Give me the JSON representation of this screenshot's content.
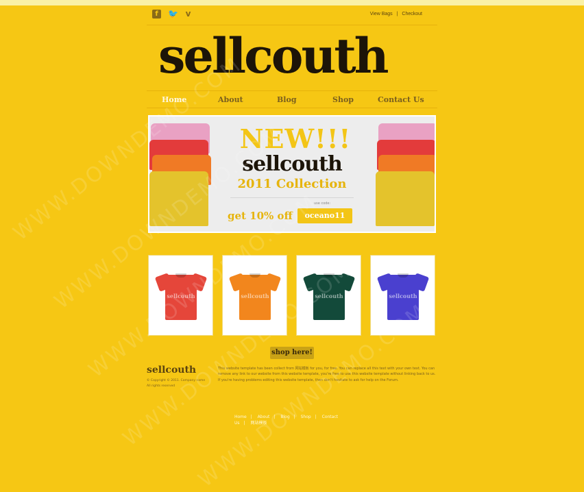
{
  "colors": {
    "background": "#f6c714",
    "accent": "#f3c516",
    "dark": "#1c1408"
  },
  "social": {
    "facebook_icon": "facebook-icon",
    "twitter_icon": "twitter-icon",
    "vimeo_icon": "vimeo-icon"
  },
  "toplinks": {
    "view_bags": "View Bags",
    "sep": "|",
    "checkout": "Checkout"
  },
  "logo": {
    "text": "sellcouth"
  },
  "nav": {
    "items": [
      {
        "label": "Home",
        "active": true
      },
      {
        "label": "About"
      },
      {
        "label": "Blog"
      },
      {
        "label": "Shop"
      },
      {
        "label": "Contact Us"
      }
    ]
  },
  "banner": {
    "new_label": "NEW!!!",
    "brand": "sellcouth",
    "collection": "2011 Collection",
    "use_code": "use code:",
    "discount": "get 10% off",
    "code": "oceano11"
  },
  "products": [
    {
      "name": "sellcouth",
      "color": "#e5463a"
    },
    {
      "name": "sellcouth",
      "color": "#f2861d"
    },
    {
      "name": "sellcouth",
      "color": "#134a3a"
    },
    {
      "name": "sellcouth",
      "color": "#4a40cf"
    }
  ],
  "shop_button": "shop here!",
  "footer": {
    "logo": "sellcouth",
    "copyright": "© Copyright © 2011. Company name All rights reserved",
    "text": "This website template has been collect from 网站模板 for you, for free. You can replace all this text with your own text. You can remove any link to our website from this website template, you're free to use this website template without linking back to us. If you're having problems editing this website template, then don't hesitate to ask for help on the Forum."
  },
  "bottom_nav": {
    "items": [
      "Home",
      "About",
      "Blog",
      "Shop",
      "Contact"
    ],
    "line2": [
      "Us",
      "网站模板"
    ],
    "sep": "|"
  },
  "watermark": "WWW.DOWNDEMO.COM"
}
